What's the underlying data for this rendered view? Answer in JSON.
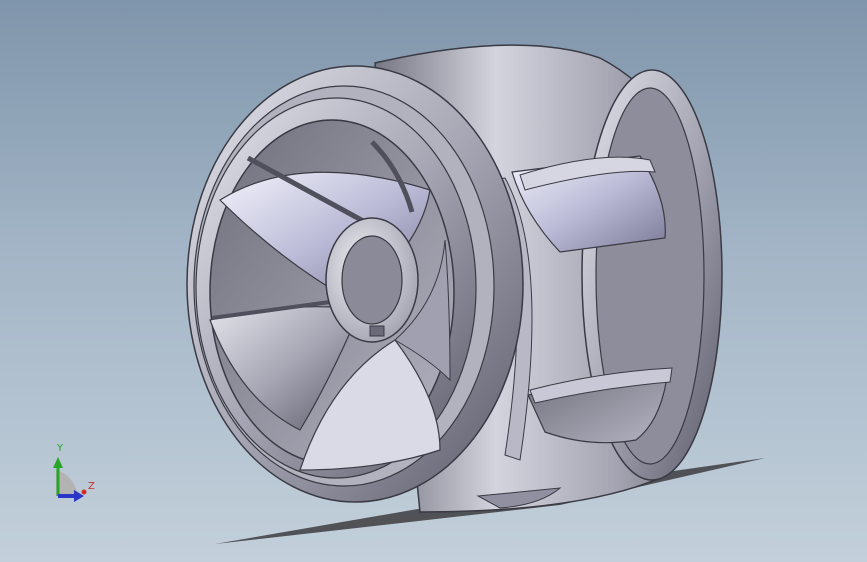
{
  "viewport": {
    "model_name": "impeller",
    "background_top": "#7f95ab",
    "background_bottom": "#c3d0db"
  },
  "triad": {
    "y_label": "Y",
    "z_label": "Z",
    "y_color": "#27a527",
    "z_color": "#d02b2b",
    "x_color": "#2a36c8"
  }
}
